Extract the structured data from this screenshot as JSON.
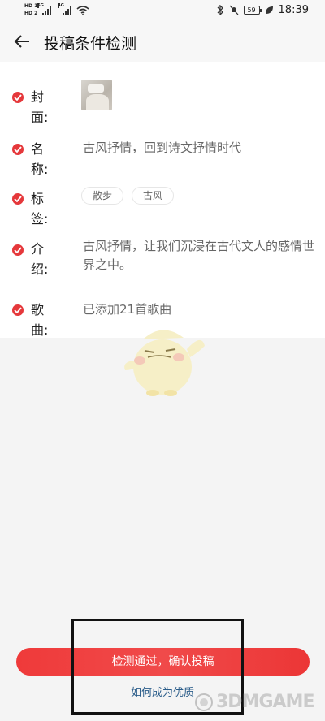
{
  "status_bar": {
    "hd1": "HD 1",
    "hd2": "HD 2",
    "signal1_tag": "5G",
    "signal2_tag": "4G",
    "battery": "59",
    "time": "18:39"
  },
  "header": {
    "title": "投稿条件检测"
  },
  "rows": {
    "cover": {
      "label": "封面:"
    },
    "name": {
      "label": "名称:",
      "value": "古风抒情，回到诗文抒情时代"
    },
    "tags": {
      "label": "标签:",
      "items": [
        "散步",
        "古风"
      ]
    },
    "intro": {
      "label": "介绍:",
      "value": "古风抒情，让我们沉浸在古代文人的感情世界之中。"
    },
    "songs": {
      "label": "歌曲:",
      "value": "已添加21首歌曲"
    }
  },
  "footer": {
    "confirm_label": "检测通过，确认投稿",
    "help_link": "如何成为优质"
  },
  "watermark": {
    "text": "3DMGAME"
  },
  "colors": {
    "accent": "#e5383b",
    "link": "#2b5d8a"
  }
}
